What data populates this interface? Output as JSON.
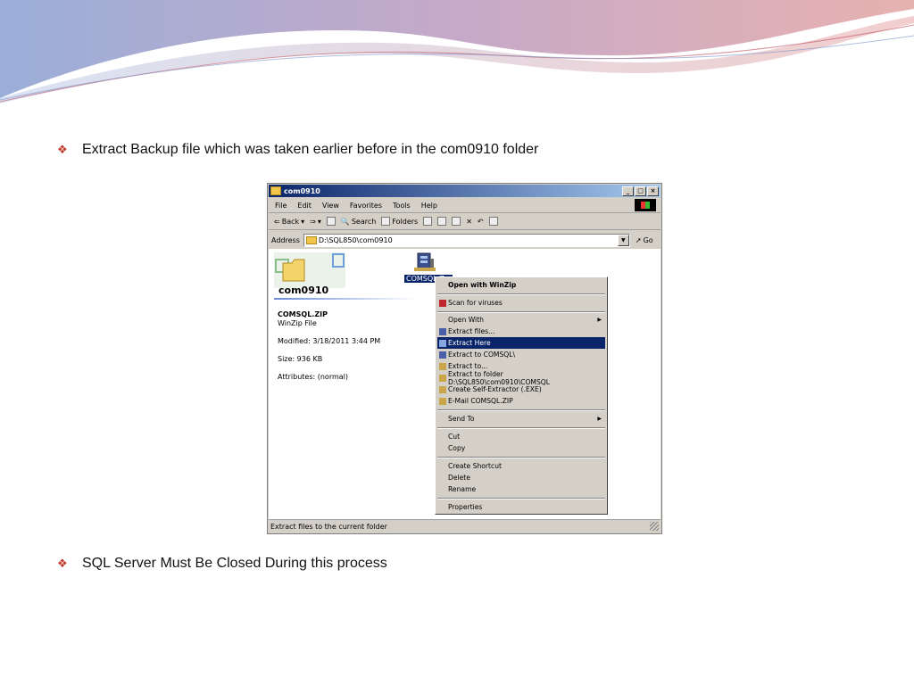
{
  "bullets": {
    "first": "Extract Backup file which was taken earlier before in the com0910 folder",
    "second": "SQL Server Must Be Closed During this process",
    "marker": "❖"
  },
  "window": {
    "title": "com0910",
    "controls": [
      "_",
      "□",
      "×"
    ],
    "menu": [
      "File",
      "Edit",
      "View",
      "Favorites",
      "Tools",
      "Help"
    ],
    "toolbar": {
      "back": "Back",
      "search": "Search",
      "folders": "Folders"
    },
    "address": {
      "label": "Address",
      "value": "D:\\SQL850\\com0910",
      "go": "Go"
    },
    "folder_title": "com0910",
    "details": {
      "name": "COMSQL.ZIP",
      "type": "WinZip File",
      "modified": "Modified: 3/18/2011 3:44 PM",
      "size": "Size: 936 KB",
      "attributes": "Attributes: (normal)"
    },
    "file_label": "COMSQL.Z...",
    "status": "Extract files to the current folder"
  },
  "context_menu": {
    "items": [
      "Open with WinZip",
      "Scan for viruses",
      "Open With",
      "Extract files...",
      "Extract Here",
      "Extract to COMSQL\\",
      "Extract to...",
      "Extract to folder D:\\SQL850\\com0910\\COMSQL",
      "Create Self-Extractor (.EXE)",
      "E-Mail COMSQL.ZIP",
      "Send To",
      "Cut",
      "Copy",
      "Create Shortcut",
      "Delete",
      "Rename",
      "Properties"
    ],
    "highlighted": "Extract Here"
  },
  "colors": {
    "title_bar": "#0a246a",
    "highlight": "#0a246a",
    "bullet": "#c0392b",
    "window_face": "#d4d0c8"
  }
}
